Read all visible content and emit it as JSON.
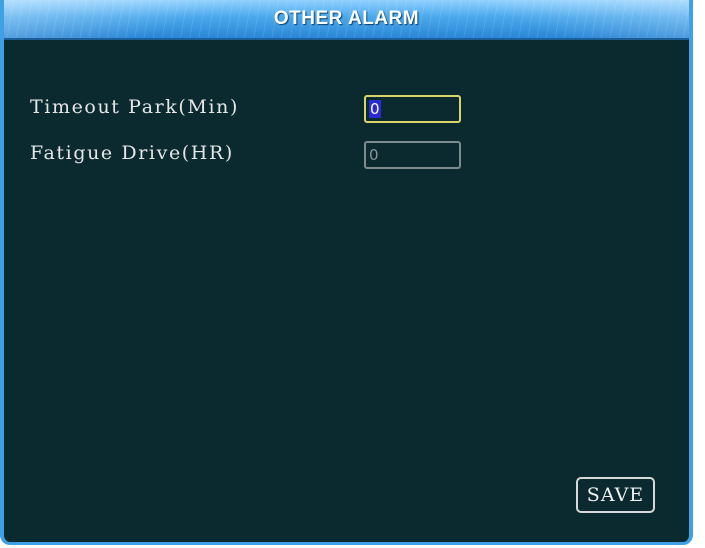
{
  "window": {
    "title": "OTHER ALARM"
  },
  "form": {
    "timeout_park": {
      "label": "Timeout Park(Min)",
      "value": "0",
      "focused": true
    },
    "fatigue_drive": {
      "label": "Fatigue Drive(HR)",
      "value": "0",
      "focused": false
    }
  },
  "actions": {
    "save_label": "SAVE"
  },
  "colors": {
    "background": "#0b2a30",
    "title_bar": "#4aa8ec",
    "focus_border": "#d9d46a",
    "selection": "#2b2bd6"
  }
}
